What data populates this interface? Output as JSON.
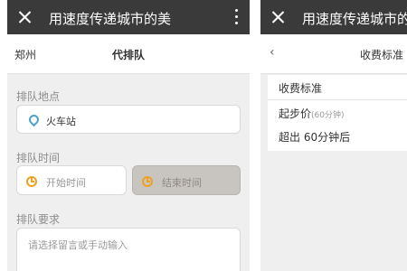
{
  "left_screen": {
    "app_title": "用速度传递城市的美",
    "city": "郑州",
    "page_title": "代排队",
    "location": {
      "label": "排队地点",
      "value": "火车站"
    },
    "time": {
      "label": "排队时间",
      "start_placeholder": "开始时间",
      "end_placeholder": "结束时间"
    },
    "requirements": {
      "label": "排队要求",
      "placeholder": "请选择留言或手动输入"
    }
  },
  "right_screen": {
    "app_title": "用速度传递城市的美",
    "back_symbol": "‹",
    "page_title": "收费标准",
    "section_header": "收费标准",
    "start_price_label": "起步价",
    "start_price_note": "(60分钟)",
    "overtime_label": "超出 60分钟后"
  },
  "icons": {
    "close": "close-icon",
    "more": "more-vertical-icon",
    "location": "location-pin-icon",
    "time": "clock-icon",
    "back": "chevron-left-icon"
  },
  "colors": {
    "topbar": "#3a3a3a",
    "page_bg": "#efefef",
    "pin": "#4ba3c7",
    "clock": "#f0a020",
    "disabled_field": "#c8c4c0"
  }
}
